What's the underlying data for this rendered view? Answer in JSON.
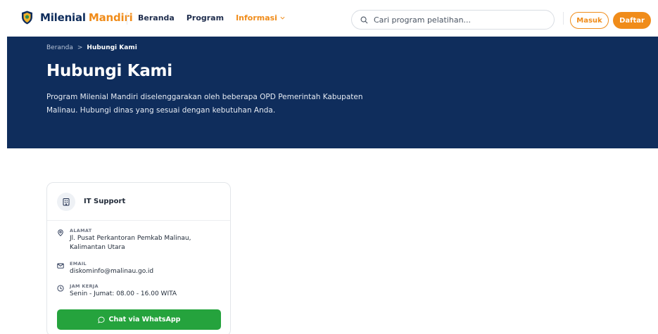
{
  "brand": {
    "part1": "Milenial",
    "part2": "Mandiri"
  },
  "nav": [
    {
      "label": "Beranda"
    },
    {
      "label": "Program"
    },
    {
      "label": "Informasi"
    }
  ],
  "search": {
    "placeholder": "Cari program pelatihan..."
  },
  "auth": {
    "login_label": "Masuk",
    "register_label": "Daftar"
  },
  "breadcrumb": {
    "home": "Beranda",
    "separator": ">",
    "current": "Hubungi Kami"
  },
  "hero": {
    "title": "Hubungi Kami",
    "description_line1": "Program Milenial Mandiri diselenggarakan oleh beberapa OPD Pemerintah Kabupaten",
    "description_line2": "Malinau. Hubungi dinas yang sesuai dengan kebutuhan Anda."
  },
  "contact_card": {
    "title": "IT Support",
    "address_label": "ALAMAT",
    "address_line1": "Jl. Pusat Perkantoran Pemkab Malinau,",
    "address_line2": "Kalimantan Utara",
    "email_label": "EMAIL",
    "email_value": "diskominfo@malinau.go.id",
    "hours_label": "JAM KERJA",
    "hours_value": "Senin - Jumat: 08.00 - 16.00 WITA",
    "whatsapp_label": "Chat via WhatsApp"
  },
  "colors": {
    "navy": "#0f2d5c",
    "orange": "#f08c1a",
    "whatsapp_green": "#25a33d"
  },
  "icons": [
    "logo-shield-icon",
    "chevron-down-icon",
    "search-icon",
    "building-icon",
    "map-pin-icon",
    "mail-icon",
    "clock-icon",
    "chat-bubble-icon"
  ]
}
